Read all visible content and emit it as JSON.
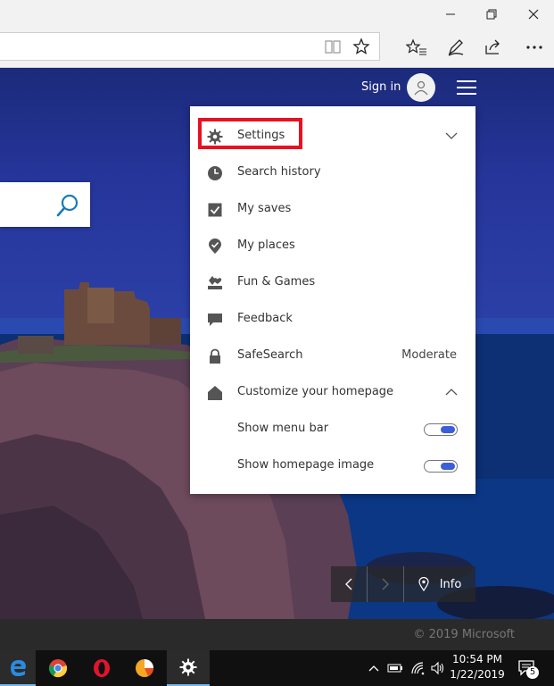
{
  "header": {
    "sign_in": "Sign in"
  },
  "menu": {
    "items": [
      {
        "label": "Settings",
        "icon": "gear-icon"
      },
      {
        "label": "Search history",
        "icon": "clock-icon"
      },
      {
        "label": "My saves",
        "icon": "checkbox-icon"
      },
      {
        "label": "My places",
        "icon": "location-check-icon"
      },
      {
        "label": "Fun & Games",
        "icon": "games-icon"
      },
      {
        "label": "Feedback",
        "icon": "chat-bubble-icon"
      },
      {
        "label": "SafeSearch",
        "icon": "lock-icon",
        "value": "Moderate"
      },
      {
        "label": "Customize your homepage",
        "icon": "home-icon"
      },
      {
        "label": "Show menu bar",
        "on": true
      },
      {
        "label": "Show homepage image",
        "on": true
      }
    ],
    "highlight_color": "#e81123",
    "toggle_color": "#3b5fd9"
  },
  "image_nav": {
    "info_label": "Info"
  },
  "footer": {
    "copyright": "© 2019 Microsoft"
  },
  "taskbar": {
    "time": "10:54 PM",
    "date": "1/22/2019",
    "notification_count": "5",
    "apps": [
      "edge-icon",
      "chrome-icon",
      "opera-icon",
      "chart-app-icon",
      "settings-icon"
    ]
  }
}
